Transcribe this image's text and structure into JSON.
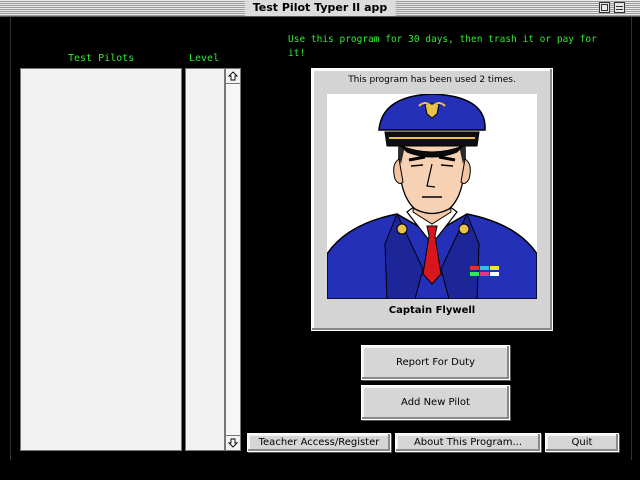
{
  "window": {
    "title": "Test Pilot Typer II app"
  },
  "notice": "Use this program for 30 days, then trash it or pay for it!",
  "columns": {
    "pilots": "Test Pilots",
    "level": "Level"
  },
  "panel": {
    "usage": "This program has been used 2 times.",
    "caption": "Captain Flywell"
  },
  "buttons": {
    "report": "Report For Duty",
    "add": "Add New Pilot",
    "teacher": "Teacher Access/Register",
    "about": "About This Program...",
    "quit": "Quit"
  },
  "colors": {
    "accent": "#31e831",
    "background": "#000000",
    "panel": "#d4d4d4"
  },
  "icons": {
    "scroll_up": "arrow-up-icon",
    "scroll_down": "arrow-down-icon",
    "portrait": "pilot-portrait"
  }
}
